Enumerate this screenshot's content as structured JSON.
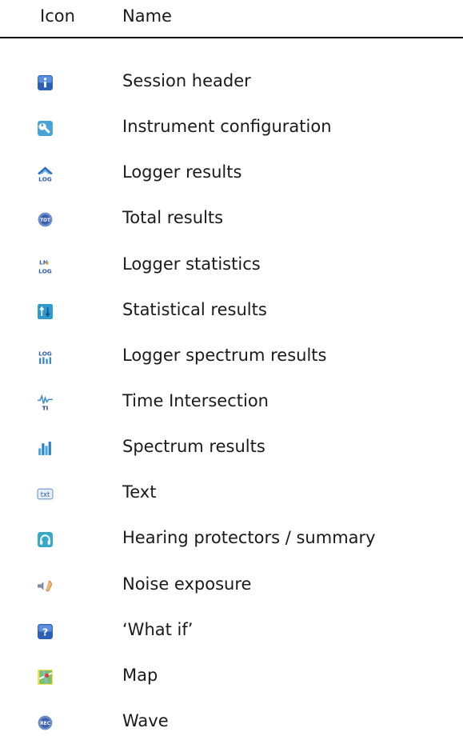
{
  "table": {
    "headers": {
      "icon": "Icon",
      "name": "Name"
    },
    "rows": [
      {
        "icon": "info-icon",
        "name": "Session header"
      },
      {
        "icon": "wrench-icon",
        "name": "Instrument configuration"
      },
      {
        "icon": "logger-results-icon",
        "name": "Logger results"
      },
      {
        "icon": "total-results-icon",
        "name": "Total results"
      },
      {
        "icon": "logger-statistics-icon",
        "name": "Logger statistics"
      },
      {
        "icon": "statistical-results-icon",
        "name": "Statistical results"
      },
      {
        "icon": "logger-spectrum-icon",
        "name": "Logger spectrum results"
      },
      {
        "icon": "time-intersection-icon",
        "name": "Time Intersection"
      },
      {
        "icon": "spectrum-results-icon",
        "name": "Spectrum results"
      },
      {
        "icon": "text-icon",
        "name": "Text"
      },
      {
        "icon": "headphones-icon",
        "name": "Hearing protectors / summary"
      },
      {
        "icon": "ear-noise-icon",
        "name": "Noise exposure"
      },
      {
        "icon": "question-icon",
        "name": "‘What if’"
      },
      {
        "icon": "map-icon",
        "name": "Map"
      },
      {
        "icon": "rec-icon",
        "name": "Wave"
      }
    ]
  }
}
